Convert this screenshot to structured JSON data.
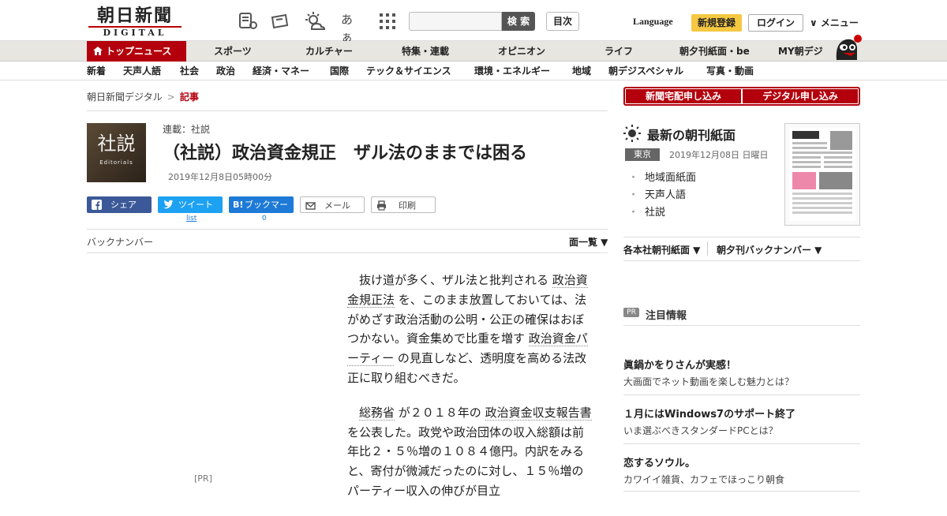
{
  "header": {
    "logo_main": "朝日新聞",
    "logo_sub": "DIGITAL",
    "search_placeholder": "",
    "search_button": "検 索",
    "toc_button": "目次",
    "language": "Language",
    "signup": "新規登録",
    "login": "ログイン",
    "menu": "∨ メニュー",
    "font_size_label": "あぁ"
  },
  "nav_primary": {
    "top_news": "トップニュース",
    "items": [
      "スポーツ",
      "カルチャー",
      "特集・連載",
      "オピニオン",
      "ライフ",
      "朝夕刊紙面・be",
      "MY朝デジ"
    ]
  },
  "nav_secondary": {
    "items": [
      "新着",
      "天声人語",
      "社会",
      "政治",
      "経済・マネー",
      "国際",
      "テック＆サイエンス",
      "環境・エネルギー",
      "地域",
      "朝デジスペシャル",
      "写真・動画"
    ]
  },
  "breadcrumb": {
    "home": "朝日新聞デジタル",
    "sep": ">",
    "current": "記事"
  },
  "article": {
    "thumb_title": "社説",
    "thumb_sub": "Editorials",
    "series": "連載：社説",
    "title": "（社説）政治資金規正　ザル法のままでは困る",
    "date": "2019年12月8日05時00分",
    "p1_a": "抜け道が多く、ザル法と批判される",
    "p1_link1": "政治資金規正法",
    "p1_b": "を、このまま放置しておいては、法がめざす政治活動の公明・公正の確保はおぼつかない。資金集めで比重を増す",
    "p1_link2": "政治資金パーティー",
    "p1_c": "の見直しなど、透明度を高める法改正に取り組むべきだ。",
    "p2_link1": "総務省",
    "p2_a": "が２０１８年の",
    "p2_link2": "政治資金収支報告書",
    "p2_b": "を公表した。政党や政治団体の収入総額は前年比２・５％増の１０８４億円。内訳をみると、寄付が微減だったのに対し、１５％増のパーティー収入の伸びが目立"
  },
  "share": {
    "facebook": "シェア",
    "twitter": "ツイート",
    "hatena": "ブックマーク",
    "mail": "メール",
    "print": "印刷",
    "twitter_count": "list",
    "hatena_count": "0"
  },
  "backnumber": {
    "label": "バックナンバー",
    "menlist": "面一覧 ▼"
  },
  "left_pr": "[PR]",
  "sidebar": {
    "subscribe_paper": "新聞宅配申し込み",
    "subscribe_digital": "デジタル申し込み",
    "latest_title": "最新の朝刊紙面",
    "region": "東京",
    "latest_date": "2019年12月08日 日曜日",
    "links": [
      "地域面紙面",
      "天声人語",
      "社説"
    ],
    "honsha": "各本社朝刊紙面 ▼",
    "yukan": "朝夕刊バックナンバー ▼",
    "pr_badge": "PR",
    "notice": "注目情報",
    "pr_items": [
      {
        "title": "眞鍋かをりさんが実感！",
        "desc": "大画面でネット動画を楽しむ魅力とは？"
      },
      {
        "title": "１月にはWindows7のサポート終了",
        "desc": "いま選ぶべきスタンダードPCとは？"
      },
      {
        "title": "恋するソウル。",
        "desc": "カワイイ雑貨、カフェでほっこり朝食"
      }
    ]
  }
}
